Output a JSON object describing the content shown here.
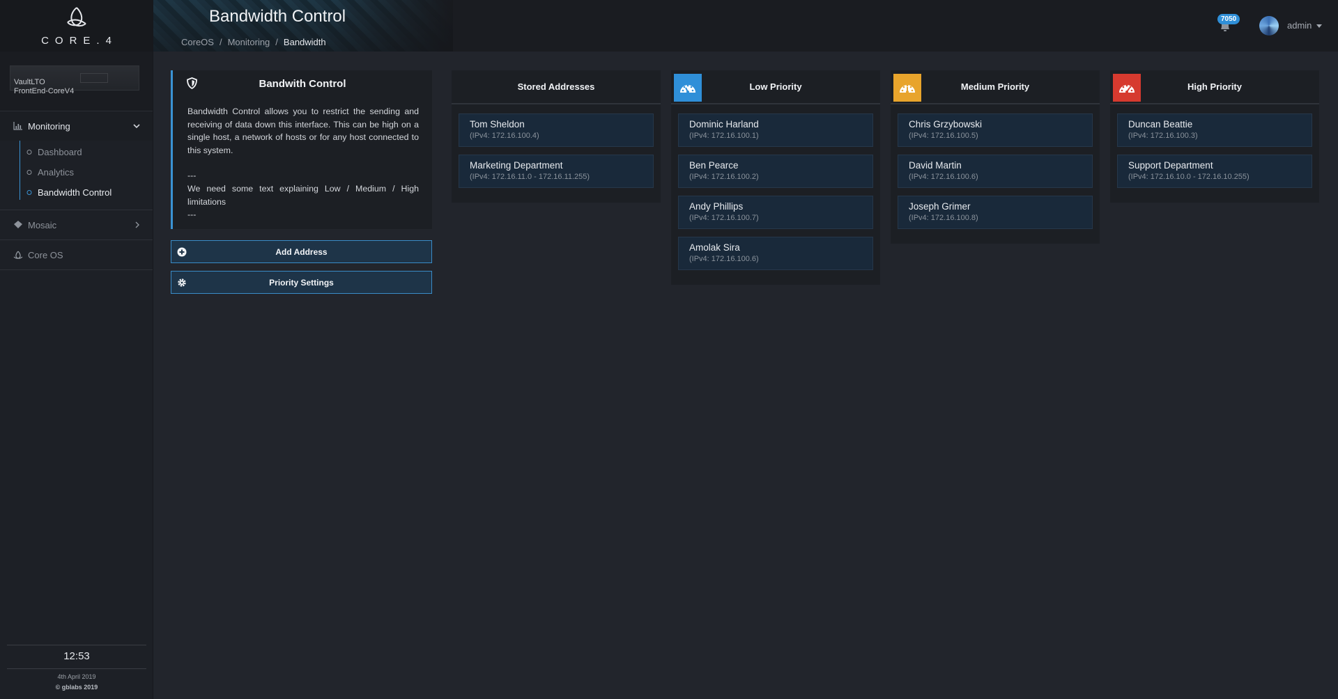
{
  "brand": {
    "name": "CORE.4"
  },
  "device": {
    "line1": "VaultLTO",
    "line2": "FrontEnd-CoreV4"
  },
  "nav": {
    "monitoring": "Monitoring",
    "sub": [
      "Dashboard",
      "Analytics",
      "Bandwidth Control"
    ],
    "mosaic": "Mosaic",
    "coreos": "Core OS"
  },
  "footer": {
    "time": "12:53",
    "date": "4th April 2019",
    "copyright": "© gblabs 2019"
  },
  "header": {
    "title": "Bandwidth Control",
    "breadcrumb": [
      "CoreOS",
      "Monitoring",
      "Bandwidth"
    ],
    "notifications": "7050",
    "user": "admin"
  },
  "info": {
    "title": "Bandwith Control",
    "para1": "Bandwidth Control allows you to restrict the sending and receiving of data down this interface. This can be high on a single host, a network of hosts or for any host connected to this system.",
    "dash1": "---",
    "para2": "We need some text explaining Low / Medium / High limitations",
    "dash2": "---"
  },
  "buttons": {
    "add": "Add Address",
    "priority": "Priority Settings"
  },
  "columns": [
    {
      "title": "Stored Addresses",
      "icon": "none",
      "color": "",
      "items": [
        {
          "name": "Tom Sheldon",
          "ip": "(IPv4: 172.16.100.4)"
        },
        {
          "name": "Marketing Department",
          "ip": "(IPv4: 172.16.11.0 - 172.16.11.255)"
        }
      ]
    },
    {
      "title": "Low Priority",
      "icon": "speedometer-icon",
      "color": "#2f8fd8",
      "items": [
        {
          "name": "Dominic Harland",
          "ip": "(IPv4: 172.16.100.1)"
        },
        {
          "name": "Ben Pearce",
          "ip": "(IPv4: 172.16.100.2)"
        },
        {
          "name": "Andy Phillips",
          "ip": "(IPv4: 172.16.100.7)"
        },
        {
          "name": "Amolak Sira",
          "ip": "(IPv4: 172.16.100.6)"
        }
      ]
    },
    {
      "title": "Medium Priority",
      "icon": "speedometer-icon",
      "color": "#e8a42c",
      "items": [
        {
          "name": "Chris Grzybowski",
          "ip": "(IPv4: 172.16.100.5)"
        },
        {
          "name": "David Martin",
          "ip": "(IPv4: 172.16.100.6)"
        },
        {
          "name": "Joseph Grimer",
          "ip": "(IPv4: 172.16.100.8)"
        }
      ]
    },
    {
      "title": "High Priority",
      "icon": "speedometer-icon",
      "color": "#d63a2f",
      "items": [
        {
          "name": "Duncan Beattie",
          "ip": "(IPv4: 172.16.100.3)"
        },
        {
          "name": "Support Department",
          "ip": "(IPv4: 172.16.10.0 - 172.16.10.255)"
        }
      ]
    }
  ]
}
